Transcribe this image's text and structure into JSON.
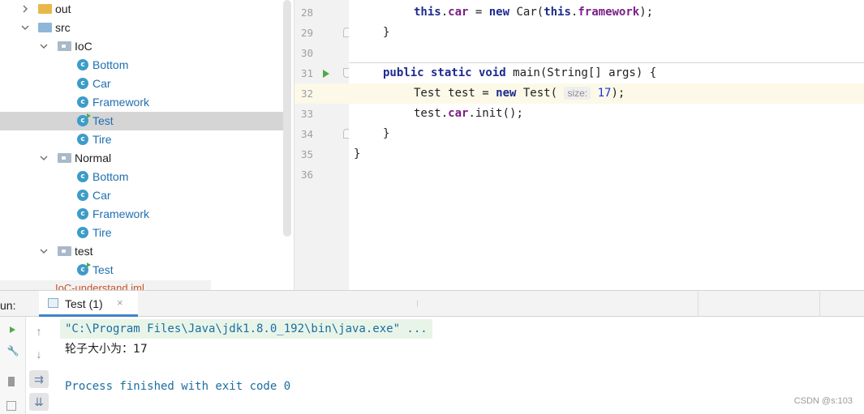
{
  "project_tree": {
    "items": [
      {
        "label": "out",
        "kind": "folder-orange",
        "expanded": false
      },
      {
        "label": "src",
        "kind": "folder-blue",
        "expanded": true
      },
      {
        "label": "IoC",
        "kind": "package",
        "expanded": true
      },
      {
        "label": "Bottom",
        "kind": "class"
      },
      {
        "label": "Car",
        "kind": "class"
      },
      {
        "label": "Framework",
        "kind": "class"
      },
      {
        "label": "Test",
        "kind": "class-run",
        "selected": true
      },
      {
        "label": "Tire",
        "kind": "class"
      },
      {
        "label": "Normal",
        "kind": "package",
        "expanded": true
      },
      {
        "label": "Bottom",
        "kind": "class"
      },
      {
        "label": "Car",
        "kind": "class"
      },
      {
        "label": "Framework",
        "kind": "class"
      },
      {
        "label": "Tire",
        "kind": "class"
      },
      {
        "label": "test",
        "kind": "package",
        "expanded": true
      },
      {
        "label": "Test",
        "kind": "class-run"
      },
      {
        "label": "IoC-understand.iml",
        "kind": "iml"
      }
    ],
    "class_icon_letter": "c"
  },
  "editor": {
    "line_numbers": [
      "28",
      "29",
      "30",
      "31",
      "32",
      "33",
      "34",
      "35",
      "36"
    ],
    "current_line": "32",
    "code": {
      "l28_this": "this",
      "l28_a": ".",
      "l28_car": "car",
      "l28_b": " = ",
      "l28_new": "new",
      "l28_c": " Car(",
      "l28_this2": "this",
      "l28_d": ".",
      "l28_fw": "framework",
      "l28_e": ");",
      "l29": "}",
      "l31_kw": "public static void",
      "l31_rest": " main(String[] args) {",
      "l32_a": "Test test = ",
      "l32_new": "new",
      "l32_b": " Test( ",
      "l32_hint": "size:",
      "l32_num": "17",
      "l32_c": ");",
      "l33_a": "test.",
      "l33_car": "car",
      "l33_b": ".init();",
      "l34": "}",
      "l35": "}"
    }
  },
  "run_panel": {
    "title": "un:",
    "tab_label": "Test (1)",
    "tab_close": "×",
    "console": {
      "command": "\"C:\\Program Files\\Java\\jdk1.8.0_192\\bin\\java.exe\" ...",
      "output": "轮子大小为：17",
      "exit": "Process finished with exit code 0"
    },
    "toolbar": {
      "up_arrow": "↑",
      "down_arrow": "↓",
      "wrap_icon": "⇉",
      "scroll_end_icon": "⇊"
    }
  },
  "watermark": "CSDN @s:103",
  "colors": {
    "keyword": "#1d2b8f",
    "field": "#7a1f85",
    "class_icon": "#3c9cc9",
    "run_green": "#4fa84a",
    "selection": "#d5d5d5",
    "current_line": "#fcf9e8"
  }
}
